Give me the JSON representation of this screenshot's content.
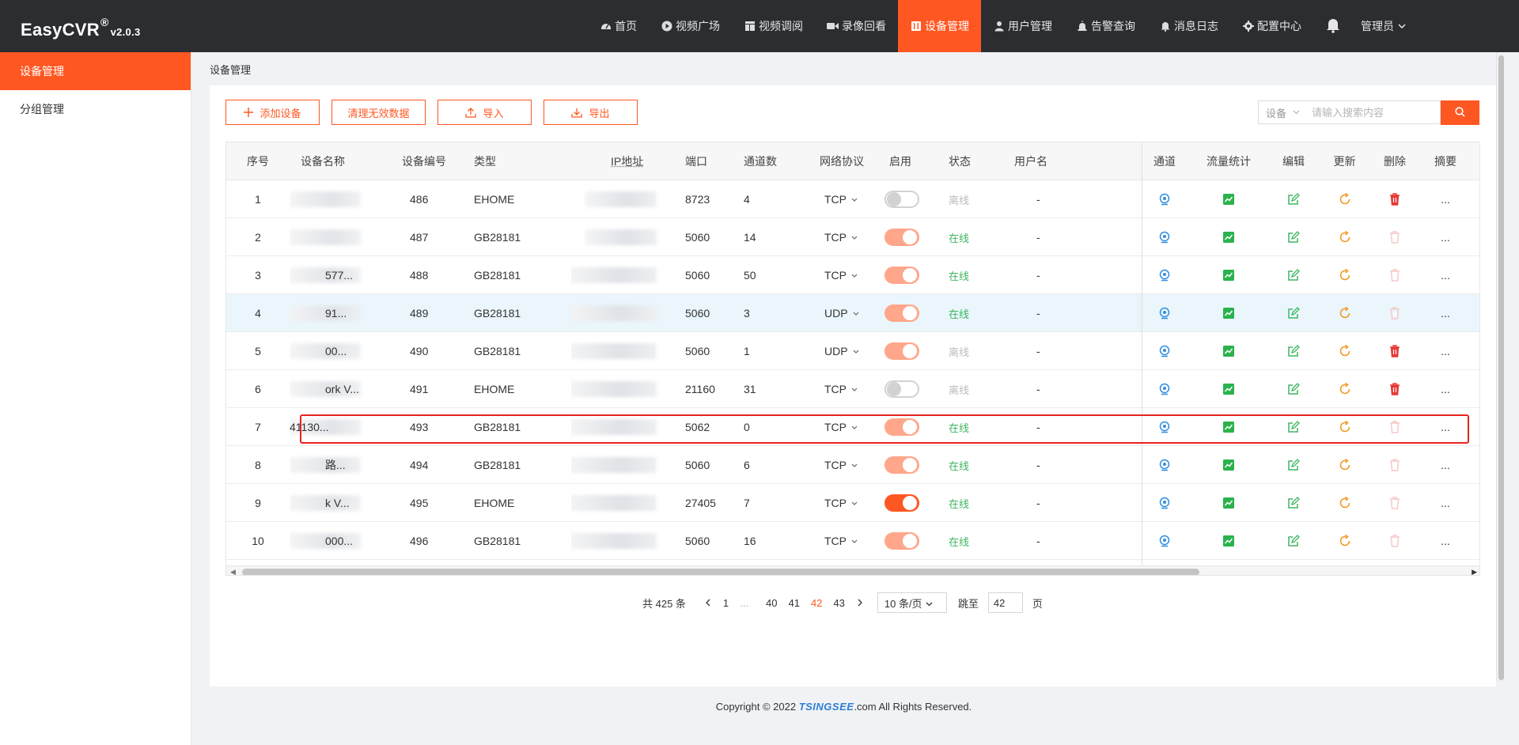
{
  "app": {
    "logo_name": "EasyCVR",
    "logo_reg": "®",
    "logo_version": "v2.0.3"
  },
  "nav": {
    "items": [
      {
        "label": "首页",
        "icon": "dashboard-icon"
      },
      {
        "label": "视频广场",
        "icon": "play-circle-icon"
      },
      {
        "label": "视频调阅",
        "icon": "layout-grid-icon"
      },
      {
        "label": "录像回看",
        "icon": "video-camera-icon"
      },
      {
        "label": "设备管理",
        "icon": "device-book-icon",
        "active": true
      },
      {
        "label": "用户管理",
        "icon": "user-icon"
      },
      {
        "label": "告警查询",
        "icon": "alarm-siren-icon"
      },
      {
        "label": "消息日志",
        "icon": "bell-small-icon"
      },
      {
        "label": "配置中心",
        "icon": "gear-icon"
      }
    ],
    "admin_label": "管理员"
  },
  "sidebar": {
    "items": [
      {
        "label": "设备管理",
        "active": true
      },
      {
        "label": "分组管理",
        "active": false
      }
    ]
  },
  "breadcrumb": "设备管理",
  "toolbar": {
    "add": "添加设备",
    "clean": "清理无效数据",
    "import": "导入",
    "export": "导出"
  },
  "search": {
    "select_value": "设备",
    "placeholder": "请输入搜索内容"
  },
  "table": {
    "headers": [
      "序号",
      "设备名称",
      "设备编号",
      "类型",
      "IP地址",
      "端口",
      "通道数",
      "网络协议",
      "启用",
      "状态",
      "用户名",
      "通道",
      "流量统计",
      "编辑",
      "更新",
      "删除",
      "摘要"
    ],
    "rows": [
      {
        "idx": "1",
        "name": "",
        "id": "486",
        "type": "EHOME",
        "port": "8723",
        "channels": "4",
        "protocol": "TCP",
        "enabled": "off",
        "status": "离线",
        "user": "-",
        "del_active": true,
        "more": "..."
      },
      {
        "idx": "2",
        "name": "",
        "id": "487",
        "type": "GB28181",
        "port": "5060",
        "channels": "14",
        "protocol": "TCP",
        "enabled": "on",
        "status": "在线",
        "user": "-",
        "del_active": false,
        "more": "..."
      },
      {
        "idx": "3",
        "name": "577...",
        "id": "488",
        "type": "GB28181",
        "port": "5060",
        "channels": "50",
        "protocol": "TCP",
        "enabled": "on",
        "status": "在线",
        "user": "-",
        "del_active": false,
        "more": "..."
      },
      {
        "idx": "4",
        "name": "91...",
        "id": "489",
        "type": "GB28181",
        "port": "5060",
        "channels": "3",
        "protocol": "UDP",
        "enabled": "on",
        "status": "在线",
        "user": "-",
        "del_active": false,
        "more": "..."
      },
      {
        "idx": "5",
        "name": "00...",
        "id": "490",
        "type": "GB28181",
        "port": "5060",
        "channels": "1",
        "protocol": "UDP",
        "enabled": "on",
        "status": "离线",
        "user": "-",
        "del_active": true,
        "more": "..."
      },
      {
        "idx": "6",
        "name": "ork V...",
        "id": "491",
        "type": "EHOME",
        "port": "21160",
        "channels": "31",
        "protocol": "TCP",
        "enabled": "off",
        "status": "离线",
        "user": "-",
        "del_active": true,
        "more": "..."
      },
      {
        "idx": "7",
        "name": "41130...",
        "id": "493",
        "type": "GB28181",
        "port": "5062",
        "channels": "0",
        "protocol": "TCP",
        "enabled": "on",
        "status": "在线",
        "user": "-",
        "del_active": false,
        "more": "..."
      },
      {
        "idx": "8",
        "name": "路...",
        "id": "494",
        "type": "GB28181",
        "port": "5060",
        "channels": "6",
        "protocol": "TCP",
        "enabled": "on",
        "status": "在线",
        "user": "-",
        "del_active": false,
        "more": "..."
      },
      {
        "idx": "9",
        "name": "k V...",
        "id": "495",
        "type": "EHOME",
        "port": "27405",
        "channels": "7",
        "protocol": "TCP",
        "enabled": "on-strong",
        "status": "在线",
        "user": "-",
        "del_active": false,
        "more": "..."
      },
      {
        "idx": "10",
        "name": "000...",
        "id": "496",
        "type": "GB28181",
        "port": "5060",
        "channels": "16",
        "protocol": "TCP",
        "enabled": "on",
        "status": "在线",
        "user": "-",
        "del_active": false,
        "more": "..."
      }
    ]
  },
  "pagination": {
    "total": "共 425 条",
    "pages": [
      "1",
      "...",
      "40",
      "41",
      "42",
      "43"
    ],
    "current": "42",
    "page_size": "10 条/页",
    "jump_label": "跳至",
    "jump_value": "42",
    "page_suffix": "页"
  },
  "footer": {
    "pre": "Copyright © 2022 ",
    "brand": "TSINGSEE",
    "post": ".com All Rights Reserved."
  },
  "colors": {
    "accent": "#ff5722",
    "header_bg": "#2b2d31",
    "online": "#3fb560",
    "channel_icon": "#2e8de0",
    "stats_icon": "#2bb24c",
    "edit_icon": "#3fb560",
    "refresh_icon": "#f29b24",
    "delete_icon": "#e53935"
  }
}
